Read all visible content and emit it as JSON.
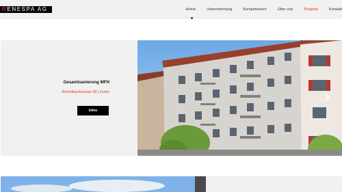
{
  "brand": {
    "logo_first": "R",
    "logo_rest": "ENESPA AG"
  },
  "nav": {
    "items": [
      {
        "label": "Home"
      },
      {
        "label": "Unternehmung"
      },
      {
        "label": "Kompetenzen"
      },
      {
        "label": "Über uns"
      },
      {
        "label": "Projekte",
        "active": true
      },
      {
        "label": "Kontakt"
      }
    ]
  },
  "project": {
    "title": "Gesamtsanierung MFH",
    "address": "Röschibachstrasse 59 | Zürich",
    "button_label": "Infos"
  },
  "colors": {
    "accent": "#e8302a",
    "panel": "#f0f0f0"
  },
  "icons": {
    "next": "chevron-right-icon"
  }
}
